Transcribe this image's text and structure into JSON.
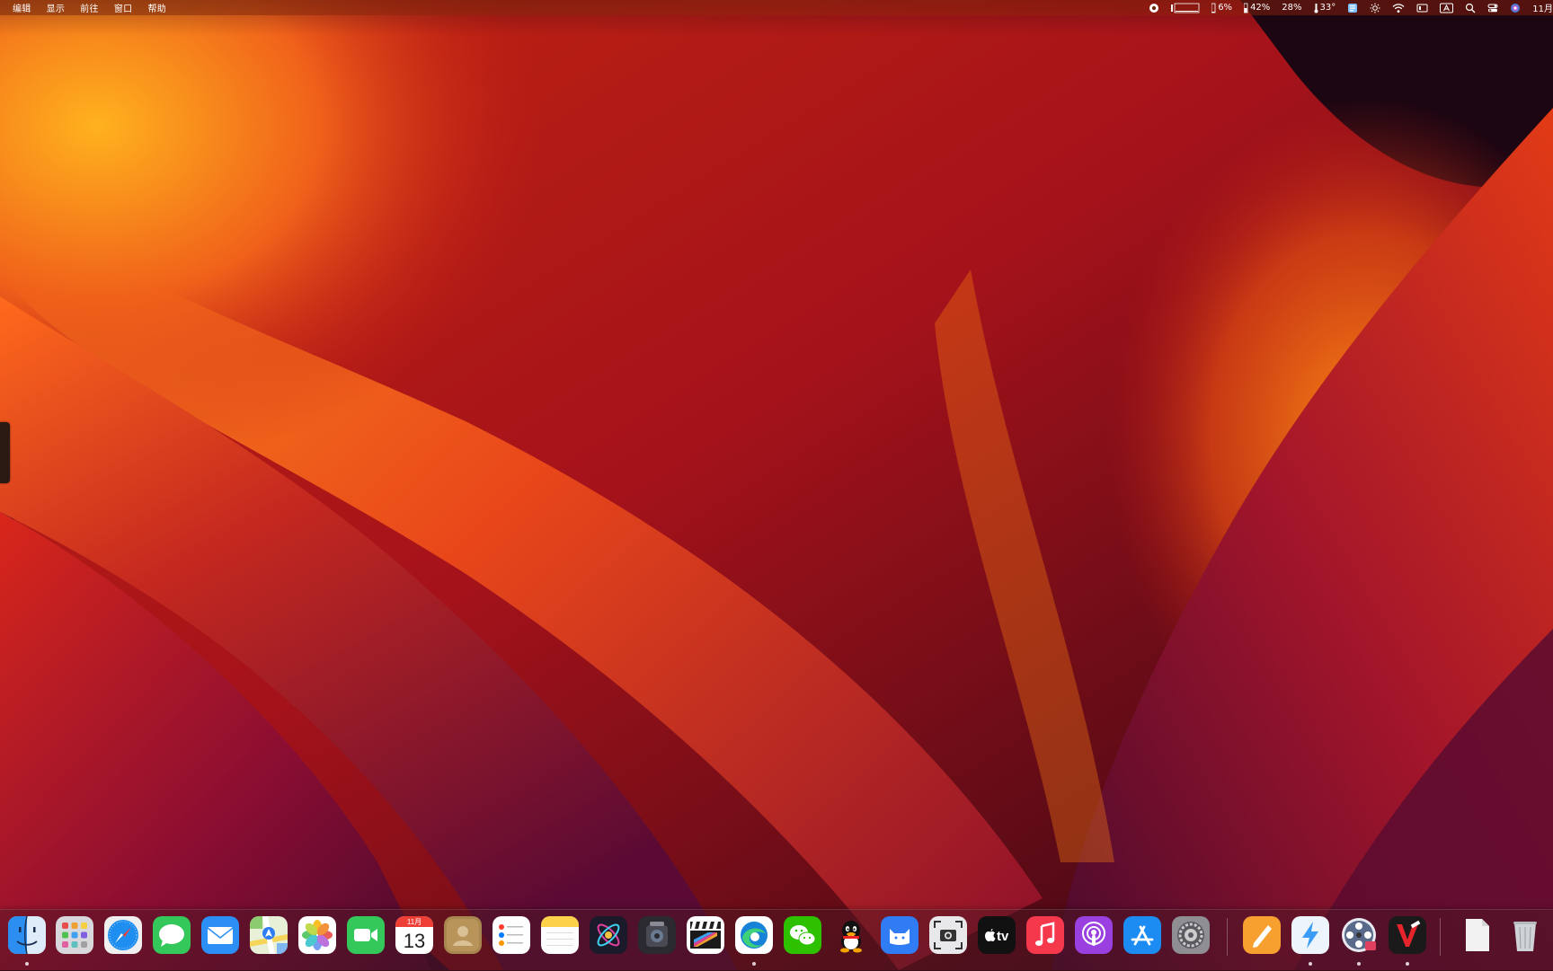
{
  "menubar": {
    "menus": [
      "编辑",
      "显示",
      "前往",
      "窗口",
      "帮助"
    ],
    "status": {
      "cpu_percent": "6%",
      "memory_percent": "42%",
      "disk_percent": "28%",
      "temperature": "33°",
      "clock_partial": "11月"
    }
  },
  "dock": {
    "calendar": {
      "month": "11月",
      "day": "13"
    },
    "tv_label": "tv",
    "apps": [
      {
        "name": "Finder",
        "icon": "finder-icon"
      },
      {
        "name": "Launchpad",
        "icon": "launchpad-icon"
      },
      {
        "name": "Safari",
        "icon": "safari-icon"
      },
      {
        "name": "Messages",
        "icon": "messages-icon"
      },
      {
        "name": "Mail",
        "icon": "mail-icon"
      },
      {
        "name": "Maps",
        "icon": "maps-icon"
      },
      {
        "name": "Photos",
        "icon": "photos-icon"
      },
      {
        "name": "FaceTime",
        "icon": "facetime-icon"
      },
      {
        "name": "Calendar",
        "icon": "calendar-icon"
      },
      {
        "name": "Contacts",
        "icon": "contacts-icon"
      },
      {
        "name": "Reminders",
        "icon": "reminders-icon"
      },
      {
        "name": "Notes",
        "icon": "notes-icon"
      },
      {
        "name": "Motion",
        "icon": "motion-icon"
      },
      {
        "name": "Compressor",
        "icon": "compressor-icon"
      },
      {
        "name": "Final Cut Pro",
        "icon": "final-cut-icon"
      },
      {
        "name": "Microsoft Edge",
        "icon": "edge-icon"
      },
      {
        "name": "WeChat",
        "icon": "wechat-icon"
      },
      {
        "name": "QQ",
        "icon": "qq-icon"
      },
      {
        "name": "Cat app",
        "icon": "cat-app-icon"
      },
      {
        "name": "Screenshot",
        "icon": "screenshot-icon"
      },
      {
        "name": "Apple TV",
        "icon": "apple-tv-icon"
      },
      {
        "name": "Music",
        "icon": "music-icon"
      },
      {
        "name": "Podcasts",
        "icon": "podcasts-icon"
      },
      {
        "name": "App Store",
        "icon": "app-store-icon"
      },
      {
        "name": "System Settings",
        "icon": "system-settings-icon"
      },
      {
        "name": "Pages",
        "icon": "pages-icon"
      },
      {
        "name": "Bolt app",
        "icon": "bolt-app-icon"
      },
      {
        "name": "Video app",
        "icon": "video-reel-icon"
      },
      {
        "name": "Red V app",
        "icon": "red-v-app-icon"
      },
      {
        "name": "Document",
        "icon": "document-icon"
      },
      {
        "name": "Trash",
        "icon": "trash-icon"
      }
    ]
  },
  "colors": {
    "wallpaper_orange": "#f7a01c",
    "wallpaper_red": "#c8181a",
    "wallpaper_dark": "#1e0712",
    "dock_tint": "#461923"
  }
}
